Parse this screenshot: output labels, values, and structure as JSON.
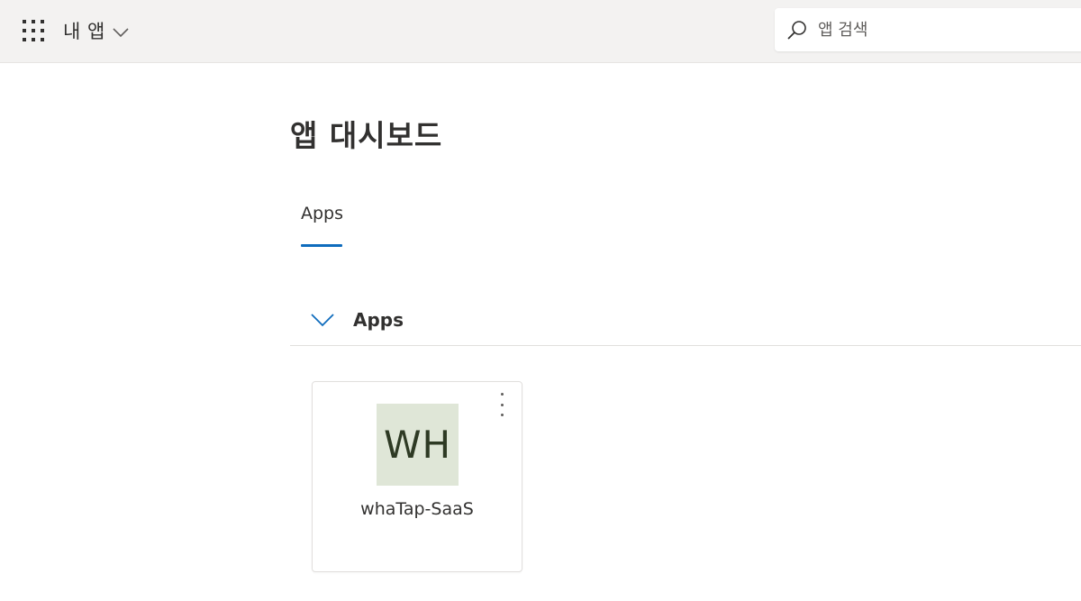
{
  "header": {
    "app_switcher_label": "내 앱",
    "waffle_icon": "waffle-grid-icon",
    "chevron_icon": "chevron-down-icon"
  },
  "search": {
    "placeholder": "앱 검색",
    "value": "",
    "icon": "search-icon"
  },
  "main": {
    "title": "앱 대시보드",
    "tabs": [
      {
        "label": "Apps",
        "active": true
      }
    ],
    "section": {
      "label": "Apps",
      "expanded": true,
      "icon": "chevron-down-icon"
    },
    "apps": [
      {
        "initials": "WH",
        "name": "whaTap-SaaS",
        "tile_color": "#dfe6d7",
        "menu_icon": "more-vertical-icon"
      }
    ]
  },
  "colors": {
    "accent": "#0f6cbd",
    "topbar_bg": "#f3f2f1"
  }
}
